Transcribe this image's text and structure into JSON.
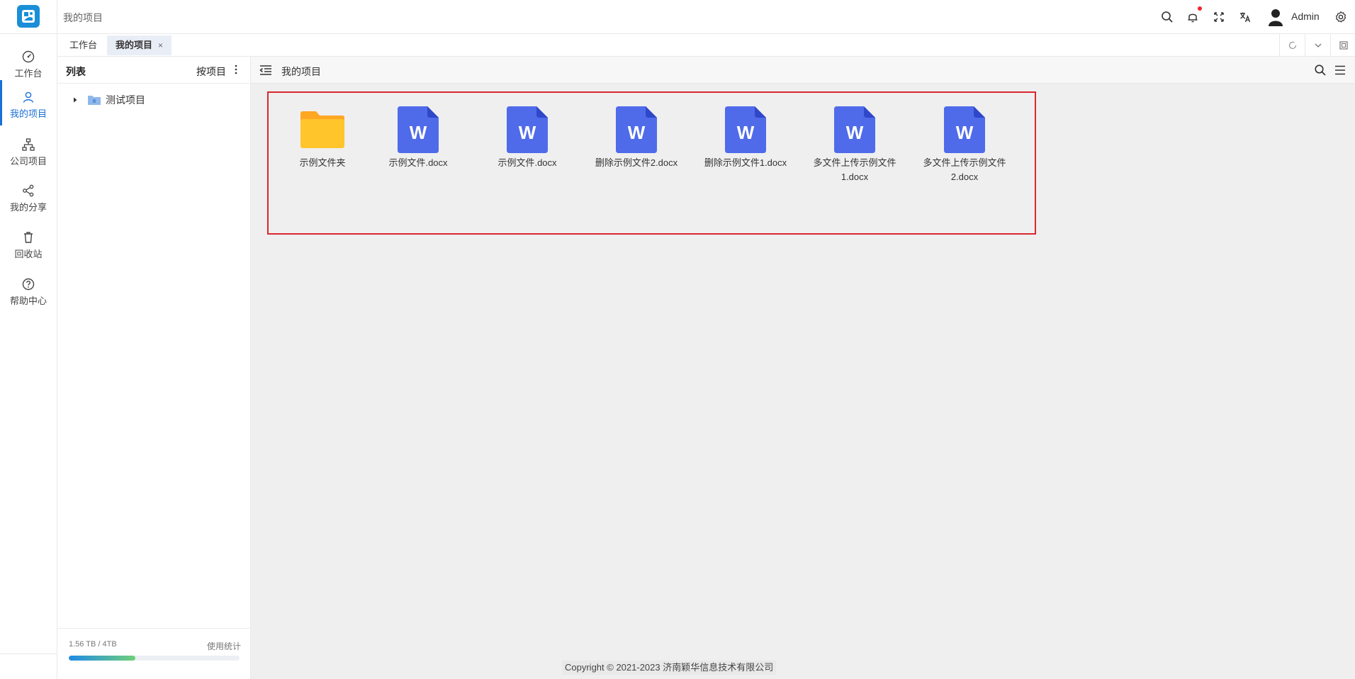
{
  "app": {
    "breadcrumb": "我的项目",
    "user": "Admin"
  },
  "nav": [
    {
      "label": "工作台",
      "icon": "dashboard-icon"
    },
    {
      "label": "我的项目",
      "icon": "user-icon",
      "active": true
    },
    {
      "label": "公司项目",
      "icon": "org-chart-icon"
    },
    {
      "label": "我的分享",
      "icon": "share-icon"
    },
    {
      "label": "回收站",
      "icon": "trash-icon"
    },
    {
      "label": "帮助中心",
      "icon": "help-icon"
    }
  ],
  "tabs": [
    {
      "label": "工作台"
    },
    {
      "label": "我的项目",
      "close": "×",
      "active": true
    }
  ],
  "sidebar": {
    "title": "列表",
    "sort_label": "按项目",
    "tree": [
      {
        "label": "测试项目"
      }
    ],
    "usage_text": "1.56 TB / 4TB",
    "usage_link": "使用统计",
    "usage_fraction": 0.39
  },
  "main": {
    "title": "我的项目",
    "files": [
      {
        "type": "folder",
        "name": "示例文件夹"
      },
      {
        "type": "docx",
        "name": "示例文件.docx"
      },
      {
        "type": "docx",
        "name": "示例文件.docx"
      },
      {
        "type": "docx",
        "name": "删除示例文件2.docx"
      },
      {
        "type": "docx",
        "name": "删除示例文件1.docx"
      },
      {
        "type": "docx",
        "name": "多文件上传示例文件1.docx"
      },
      {
        "type": "docx",
        "name": "多文件上传示例文件2.docx"
      }
    ],
    "footer": "Copyright © 2021-2023 济南颖华信息技术有限公司"
  },
  "colors": {
    "accent": "#1a6fd8",
    "word": "#4f6bea",
    "folder": "#ffc52b",
    "selection": "#d9272e"
  }
}
